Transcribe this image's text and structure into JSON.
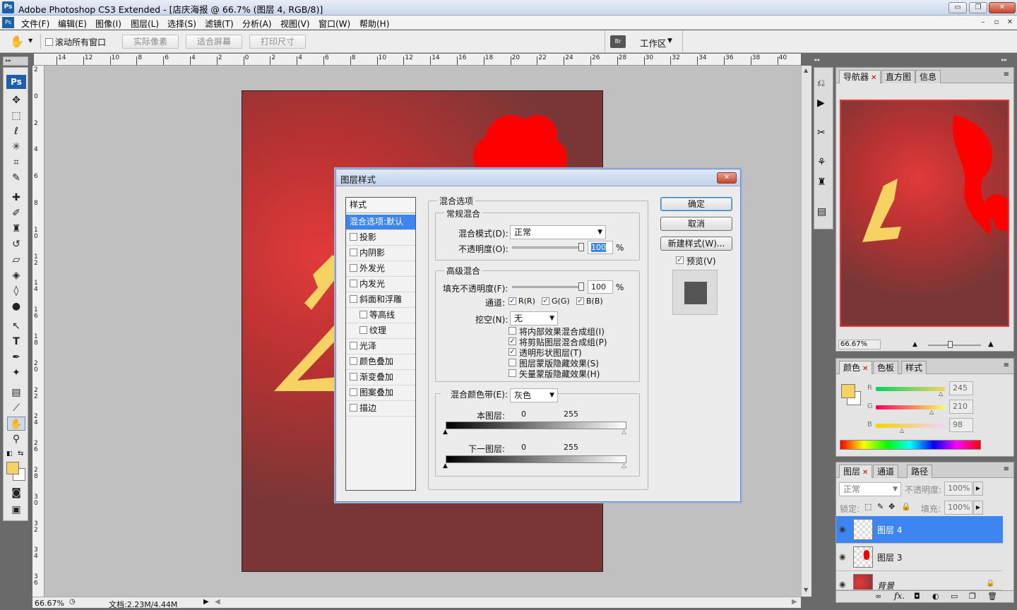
{
  "window": {
    "title": "Adobe Photoshop CS3 Extended - [店庆海报 @ 66.7% (图层 4, RGB/8)]",
    "app_badge": "Ps",
    "controls": {
      "minimize": "▭",
      "restore": "❐",
      "close": "✕"
    },
    "doc_controls": {
      "minimize": "–",
      "restore": "▫",
      "close": "✕"
    }
  },
  "menu": [
    "文件(F)",
    "编辑(E)",
    "图像(I)",
    "图层(L)",
    "选择(S)",
    "滤镜(T)",
    "分析(A)",
    "视图(V)",
    "窗口(W)",
    "帮助(H)"
  ],
  "options_bar": {
    "scroll_all_label": "滚动所有窗口",
    "scroll_all_checked": false,
    "buttons": [
      "实际像素",
      "适合屏幕",
      "打印尺寸"
    ],
    "workspace_label": "工作区"
  },
  "ruler_top": [
    "14",
    "12",
    "10",
    "8",
    "6",
    "4",
    "2",
    "0",
    "2",
    "4",
    "6",
    "8",
    "10",
    "12",
    "14",
    "16",
    "18",
    "20",
    "22",
    "24",
    "26",
    "28",
    "30",
    "32",
    "34",
    "36",
    "38",
    "40"
  ],
  "ruler_left": [
    "2",
    "0",
    "2",
    "4",
    "6",
    "8",
    "1\n0",
    "1\n2",
    "1\n4",
    "1\n6",
    "1\n8",
    "2\n0",
    "2\n2",
    "2\n4",
    "2\n6",
    "2\n8",
    "3\n0",
    "3\n2",
    "3\n4",
    "3\n6"
  ],
  "status_bar": {
    "zoom": "66.67%",
    "doc_info": "文档:2.23M/4.44M"
  },
  "colors": {
    "foreground": "#f5d262",
    "canvas_red": "#e23a3a",
    "selection_blue": "#3d86f2"
  },
  "dialog": {
    "title": "图层样式",
    "styles_header": "样式",
    "styles": [
      {
        "label": "混合选项:默认",
        "selected": true,
        "has_checkbox": false,
        "indent": false
      },
      {
        "label": "投影",
        "checked": false,
        "has_checkbox": true,
        "indent": false
      },
      {
        "label": "内阴影",
        "checked": false,
        "has_checkbox": true,
        "indent": false
      },
      {
        "label": "外发光",
        "checked": false,
        "has_checkbox": true,
        "indent": false
      },
      {
        "label": "内发光",
        "checked": false,
        "has_checkbox": true,
        "indent": false
      },
      {
        "label": "斜面和浮雕",
        "checked": false,
        "has_checkbox": true,
        "indent": false
      },
      {
        "label": "等高线",
        "checked": false,
        "has_checkbox": true,
        "indent": true
      },
      {
        "label": "纹理",
        "checked": false,
        "has_checkbox": true,
        "indent": true
      },
      {
        "label": "光泽",
        "checked": false,
        "has_checkbox": true,
        "indent": false
      },
      {
        "label": "颜色叠加",
        "checked": false,
        "has_checkbox": true,
        "indent": false
      },
      {
        "label": "渐变叠加",
        "checked": false,
        "has_checkbox": true,
        "indent": false
      },
      {
        "label": "图案叠加",
        "checked": false,
        "has_checkbox": true,
        "indent": false
      },
      {
        "label": "描边",
        "checked": false,
        "has_checkbox": true,
        "indent": false
      }
    ],
    "blend_options_title": "混合选项",
    "general_title": "常规混合",
    "blend_mode_label": "混合模式(D):",
    "blend_mode_value": "正常",
    "opacity_label": "不透明度(O):",
    "opacity_value": "100",
    "percent": "%",
    "advanced_title": "高级混合",
    "fill_opacity_label": "填充不透明度(F):",
    "fill_opacity_value": "100",
    "channels_label": "通道:",
    "channels": [
      {
        "label": "R(R)",
        "checked": true
      },
      {
        "label": "G(G)",
        "checked": true
      },
      {
        "label": "B(B)",
        "checked": true
      }
    ],
    "knockout_label": "挖空(N):",
    "knockout_value": "无",
    "advanced_options": [
      {
        "label": "将内部效果混合成组(I)",
        "checked": false
      },
      {
        "label": "将剪贴图层混合成组(P)",
        "checked": true
      },
      {
        "label": "透明形状图层(T)",
        "checked": true
      },
      {
        "label": "图层蒙版隐藏效果(S)",
        "checked": false
      },
      {
        "label": "矢量蒙版隐藏效果(H)",
        "checked": false
      }
    ],
    "blend_if_label": "混合颜色带(E):",
    "blend_if_value": "灰色",
    "this_layer_label": "本图层:",
    "this_layer_min": "0",
    "this_layer_max": "255",
    "underlying_label": "下一图层:",
    "underlying_min": "0",
    "underlying_max": "255",
    "buttons": {
      "ok": "确定",
      "cancel": "取消",
      "new_style": "新建样式(W)..."
    },
    "preview_label": "预览(V)",
    "preview_checked": true
  },
  "navigator_panel": {
    "tabs": [
      "导航器",
      "直方图",
      "信息"
    ],
    "zoom": "66.67%"
  },
  "color_panel": {
    "tabs": [
      "颜色",
      "色板",
      "样式"
    ],
    "r_label": "R",
    "g_label": "G",
    "b_label": "B",
    "r": "245",
    "g": "210",
    "b": "98"
  },
  "layers_panel": {
    "tabs": [
      "图层",
      "通道",
      "路径"
    ],
    "blend_mode": "正常",
    "opacity_label": "不透明度:",
    "opacity": "100%",
    "lock_label": "锁定:",
    "fill_label": "填充:",
    "fill": "100%",
    "layers": [
      {
        "name": "图层 4",
        "selected": true
      },
      {
        "name": "图层 3",
        "selected": false
      },
      {
        "name": "背景",
        "selected": false
      }
    ],
    "footer_icons": [
      "link-icon",
      "fx-icon",
      "mask-icon",
      "adjustment-icon",
      "group-icon",
      "new-layer-icon",
      "trash-icon"
    ],
    "fx_label": "fx."
  }
}
